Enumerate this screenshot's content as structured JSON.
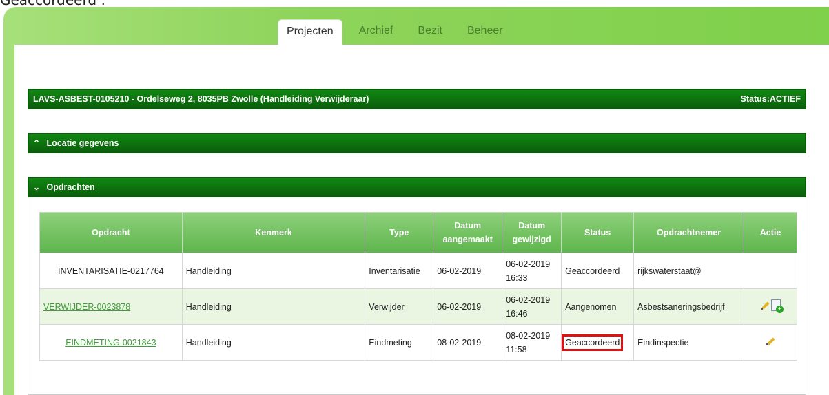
{
  "caption": "Geaccordeerd :",
  "tabs": [
    {
      "label": "Projecten",
      "active": true
    },
    {
      "label": "Archief",
      "active": false
    },
    {
      "label": "Bezit",
      "active": false
    },
    {
      "label": "Beheer",
      "active": false
    }
  ],
  "project": {
    "title": "LAVS-ASBEST-0105210 - Ordelseweg 2, 8035PB Zwolle (Handleiding Verwijderaar)",
    "status": "Status:ACTIEF"
  },
  "locatie": {
    "label": "Locatie gegevens",
    "icon": "chevron-up-icon"
  },
  "opdrachten": {
    "label": "Opdrachten",
    "icon": "chevron-down-icon",
    "columns": [
      "Opdracht",
      "Kenmerk",
      "Type",
      "Datum aangemaakt",
      "Datum gewijzigd",
      "Status",
      "Opdrachtnemer",
      "Actie"
    ],
    "rows": [
      {
        "opdracht": "INVENTARISATIE-0217764",
        "kenmerk": "Handleiding",
        "type": "Inventarisatie",
        "aangemaakt": "06-02-2019",
        "gewijzigd_date": "06-02-2019",
        "gewijzigd_time": "16:33",
        "status": "Geaccordeerd",
        "opdrachtnemer": "rijkswaterstaat@",
        "link": false,
        "actions": []
      },
      {
        "opdracht": "VERWIJDER-0023878",
        "kenmerk": "Handleiding",
        "type": "Verwijder",
        "aangemaakt": "06-02-2019",
        "gewijzigd_date": "06-02-2019",
        "gewijzigd_time": "16:46",
        "status": "Aangenomen",
        "opdrachtnemer": "Asbestsaneringsbedrijf",
        "link": true,
        "actions": [
          "pencil-icon",
          "document-add-icon"
        ]
      },
      {
        "opdracht": "EINDMETING-0021843",
        "kenmerk": "Handleiding",
        "type": "Eindmeting",
        "aangemaakt": "08-02-2019",
        "gewijzigd_date": "08-02-2019",
        "gewijzigd_time": "11:58",
        "status": "Geaccordeerd",
        "opdrachtnemer": "Eindinspectie",
        "link": true,
        "actions": [
          "pencil-icon"
        ]
      }
    ]
  },
  "colors": {
    "header_green": "#0b5e0b",
    "frame_green": "#8fd45c",
    "highlight": "#e01010",
    "link": "#3f9e3a"
  }
}
